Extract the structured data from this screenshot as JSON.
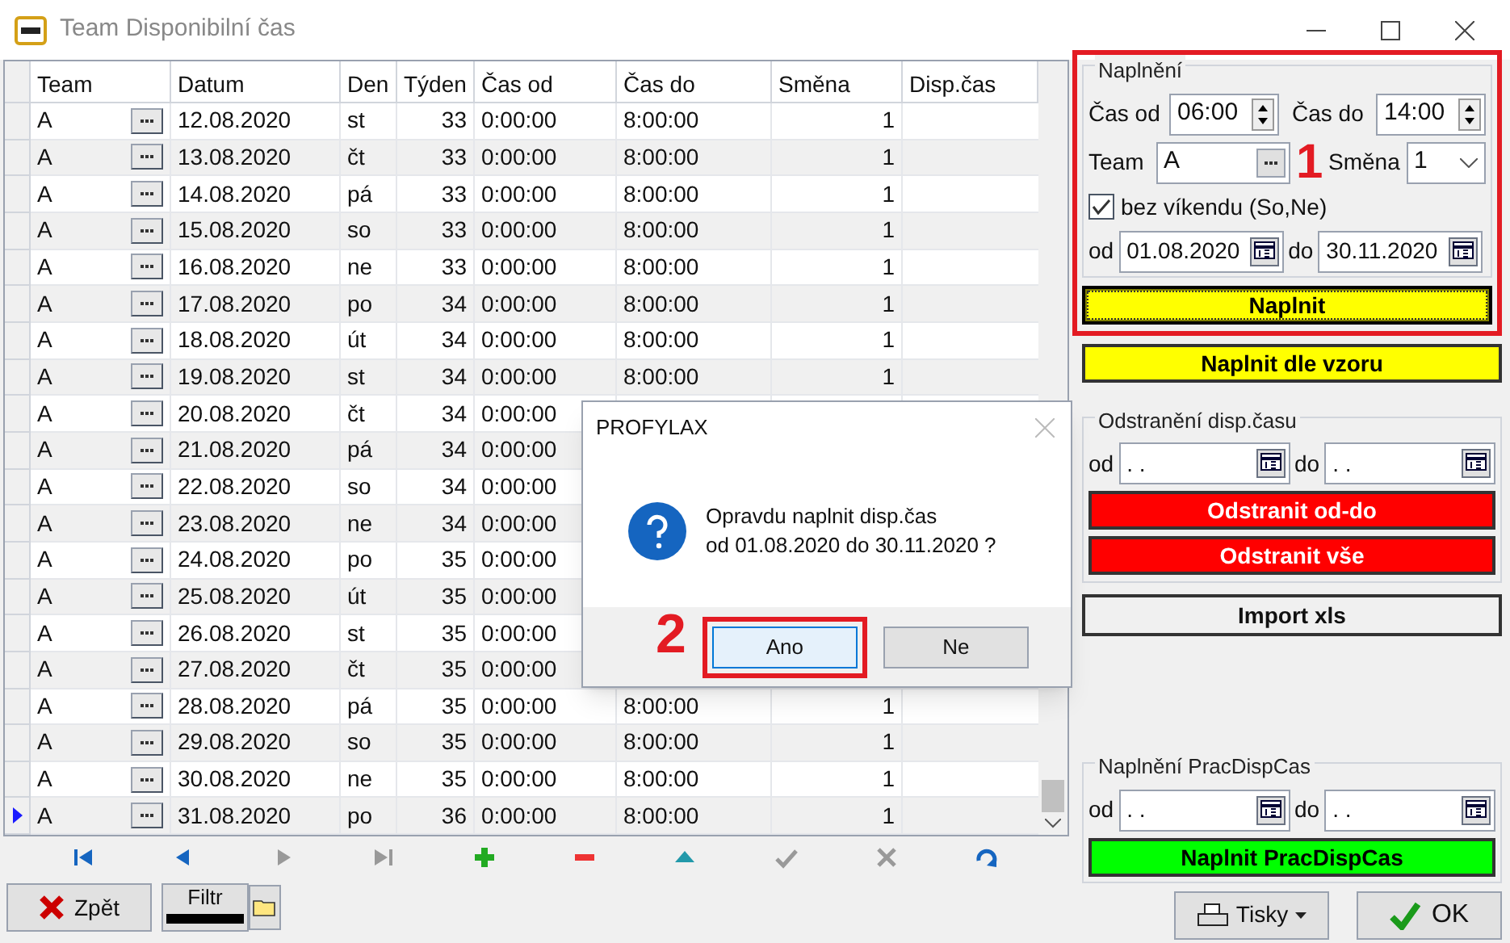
{
  "window": {
    "title": "Team Disponibilní čas"
  },
  "table": {
    "columns": [
      "Team",
      "Datum",
      "Den",
      "Týden",
      "Čas od",
      "Čas do",
      "Směna",
      "Disp.čas"
    ],
    "rows": [
      {
        "team": "A",
        "datum": "12.08.2020",
        "den": "st",
        "tyden": "33",
        "cas_od": "0:00:00",
        "cas_do": "8:00:00",
        "smena": "1",
        "selected": false
      },
      {
        "team": "A",
        "datum": "13.08.2020",
        "den": "čt",
        "tyden": "33",
        "cas_od": "0:00:00",
        "cas_do": "8:00:00",
        "smena": "1",
        "selected": false
      },
      {
        "team": "A",
        "datum": "14.08.2020",
        "den": "pá",
        "tyden": "33",
        "cas_od": "0:00:00",
        "cas_do": "8:00:00",
        "smena": "1",
        "selected": false
      },
      {
        "team": "A",
        "datum": "15.08.2020",
        "den": "so",
        "tyden": "33",
        "cas_od": "0:00:00",
        "cas_do": "8:00:00",
        "smena": "1",
        "selected": false
      },
      {
        "team": "A",
        "datum": "16.08.2020",
        "den": "ne",
        "tyden": "33",
        "cas_od": "0:00:00",
        "cas_do": "8:00:00",
        "smena": "1",
        "selected": false
      },
      {
        "team": "A",
        "datum": "17.08.2020",
        "den": "po",
        "tyden": "34",
        "cas_od": "0:00:00",
        "cas_do": "8:00:00",
        "smena": "1",
        "selected": false
      },
      {
        "team": "A",
        "datum": "18.08.2020",
        "den": "út",
        "tyden": "34",
        "cas_od": "0:00:00",
        "cas_do": "8:00:00",
        "smena": "1",
        "selected": false
      },
      {
        "team": "A",
        "datum": "19.08.2020",
        "den": "st",
        "tyden": "34",
        "cas_od": "0:00:00",
        "cas_do": "8:00:00",
        "smena": "1",
        "selected": false
      },
      {
        "team": "A",
        "datum": "20.08.2020",
        "den": "čt",
        "tyden": "34",
        "cas_od": "0:00:00",
        "selected": false
      },
      {
        "team": "A",
        "datum": "21.08.2020",
        "den": "pá",
        "tyden": "34",
        "cas_od": "0:00:00",
        "selected": false
      },
      {
        "team": "A",
        "datum": "22.08.2020",
        "den": "so",
        "tyden": "34",
        "cas_od": "0:00:00",
        "selected": false
      },
      {
        "team": "A",
        "datum": "23.08.2020",
        "den": "ne",
        "tyden": "34",
        "cas_od": "0:00:00",
        "selected": false
      },
      {
        "team": "A",
        "datum": "24.08.2020",
        "den": "po",
        "tyden": "35",
        "cas_od": "0:00:00",
        "selected": false
      },
      {
        "team": "A",
        "datum": "25.08.2020",
        "den": "út",
        "tyden": "35",
        "cas_od": "0:00:00",
        "selected": false
      },
      {
        "team": "A",
        "datum": "26.08.2020",
        "den": "st",
        "tyden": "35",
        "cas_od": "0:00:00",
        "selected": false
      },
      {
        "team": "A",
        "datum": "27.08.2020",
        "den": "čt",
        "tyden": "35",
        "cas_od": "0:00:00",
        "selected": false
      },
      {
        "team": "A",
        "datum": "28.08.2020",
        "den": "pá",
        "tyden": "35",
        "cas_od": "0:00:00",
        "cas_do": "8:00:00",
        "smena": "1",
        "selected": false
      },
      {
        "team": "A",
        "datum": "29.08.2020",
        "den": "so",
        "tyden": "35",
        "cas_od": "0:00:00",
        "cas_do": "8:00:00",
        "smena": "1",
        "selected": false
      },
      {
        "team": "A",
        "datum": "30.08.2020",
        "den": "ne",
        "tyden": "35",
        "cas_od": "0:00:00",
        "cas_do": "8:00:00",
        "smena": "1",
        "selected": false
      },
      {
        "team": "A",
        "datum": "31.08.2020",
        "den": "po",
        "tyden": "36",
        "cas_od": "0:00:00",
        "cas_do": "8:00:00",
        "smena": "1",
        "selected": true
      }
    ]
  },
  "navigator": [
    {
      "kind": "first",
      "disabled": false
    },
    {
      "kind": "prior",
      "disabled": false
    },
    {
      "kind": "next",
      "disabled": true
    },
    {
      "kind": "last",
      "disabled": true
    },
    {
      "kind": "insert",
      "disabled": false
    },
    {
      "kind": "delete",
      "disabled": false
    },
    {
      "kind": "edit",
      "disabled": false
    },
    {
      "kind": "post",
      "disabled": true
    },
    {
      "kind": "cancel",
      "disabled": true
    },
    {
      "kind": "refresh",
      "disabled": false
    }
  ],
  "bottom": {
    "back": "Zpět",
    "filter": "Filtr",
    "print": "Tisky",
    "ok": "OK"
  },
  "fill": {
    "legend": "Naplnění",
    "cas_od_label": "Čas od",
    "cas_od": "06:00",
    "cas_do_label": "Čas do",
    "cas_do": "14:00",
    "team_label": "Team",
    "team": "A",
    "smena_label": "Směna",
    "smena": "1",
    "weekend_label": "bez víkendu (So,Ne)",
    "weekend_checked": true,
    "od_label": "od",
    "od": "01.08.2020",
    "do_label": "do",
    "do": "30.11.2020",
    "buttons": [
      {
        "label": "Naplnit",
        "color": "#ffff00",
        "focused": true
      },
      {
        "label": "Naplnit dle vzoru",
        "color": "#ffff00",
        "focused": false
      }
    ]
  },
  "remove": {
    "legend": "Odstranění disp.času",
    "od_label": "od",
    "od": ". .",
    "do_label": "do",
    "do": ". .",
    "buttons": [
      {
        "label": "Odstranit od-do",
        "color": "#ff0000"
      },
      {
        "label": "Odstranit vše",
        "color": "#ff0000"
      }
    ]
  },
  "import": {
    "label": "Import xls"
  },
  "work": {
    "legend": "Naplnění PracDispCas",
    "od_label": "od",
    "od": ". .",
    "do_label": "do",
    "do": ". .",
    "buttons": [
      {
        "label": "Naplnit PracDispCas",
        "color": "#00ff00"
      }
    ]
  },
  "dialog": {
    "title": "PROFYLAX",
    "lines": [
      "Opravdu naplnit disp.čas",
      "od 01.08.2020 do 30.11.2020 ?"
    ],
    "buttons": [
      {
        "label": "Ano",
        "selected": true
      },
      {
        "label": "Ne",
        "selected": false
      }
    ]
  },
  "annotations": [
    "1",
    "2"
  ]
}
